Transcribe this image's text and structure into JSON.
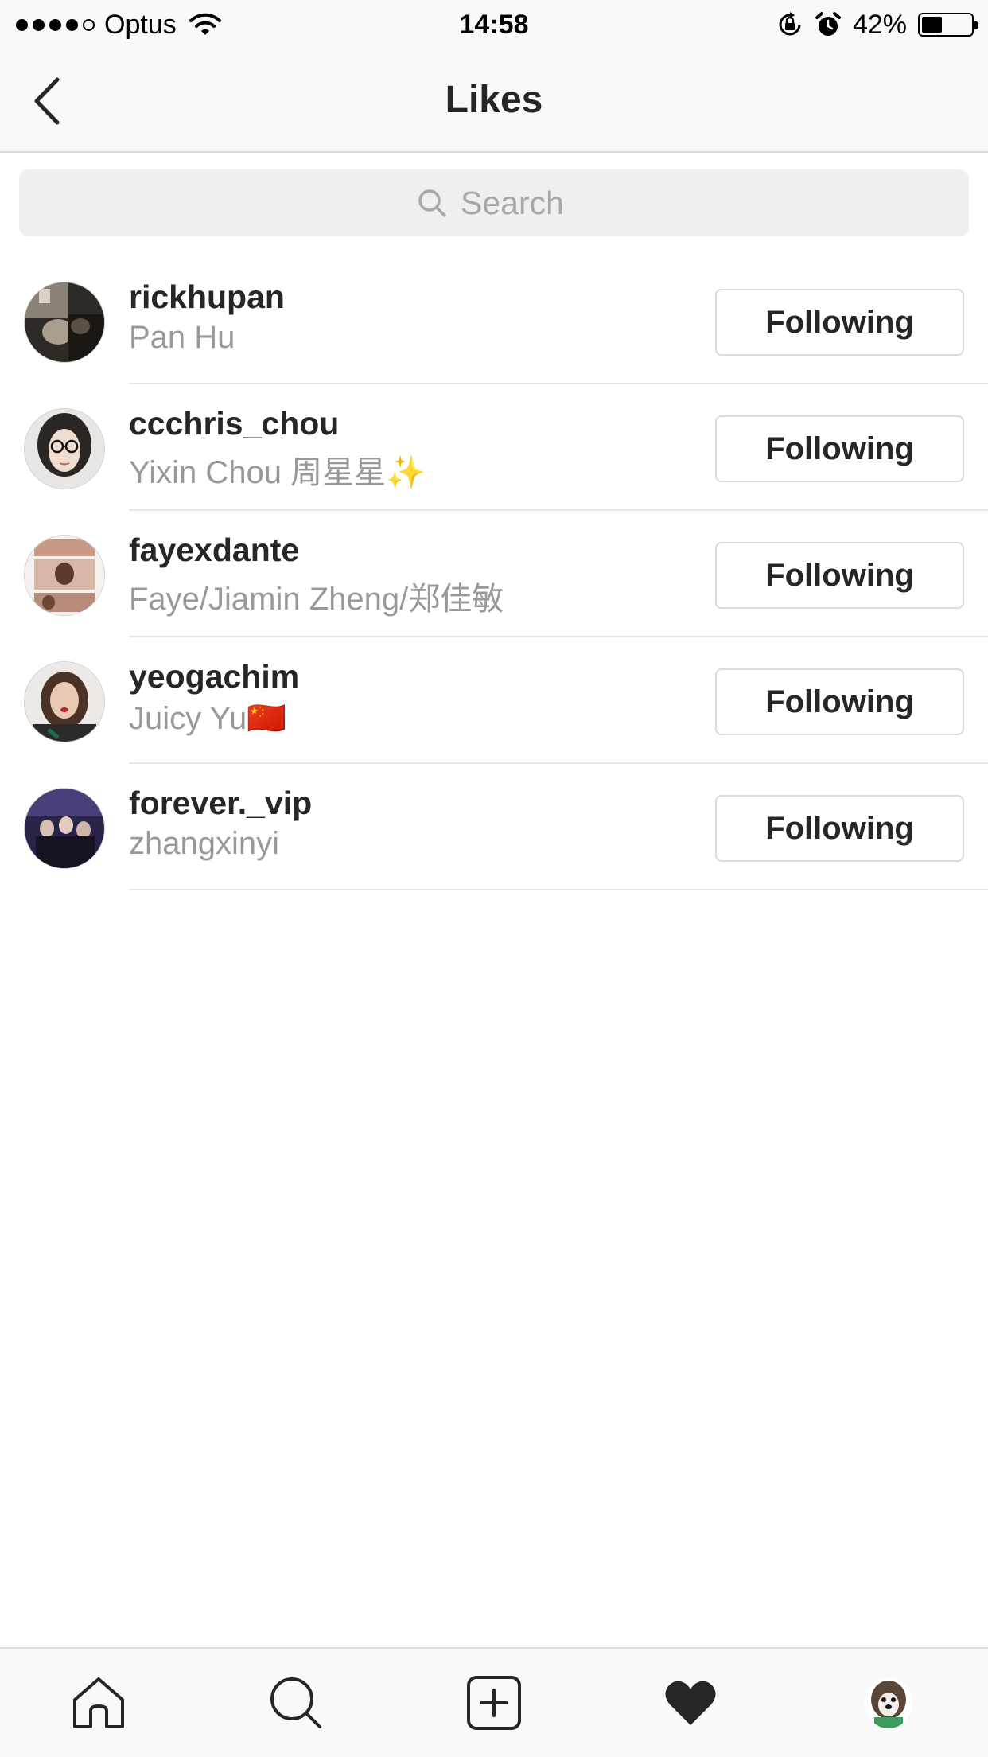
{
  "status_bar": {
    "carrier": "Optus",
    "time": "14:58",
    "battery_percent": "42%",
    "battery_level": 0.42,
    "signal_bars": 4,
    "signal_bars_total": 5
  },
  "nav": {
    "title": "Likes",
    "back_icon": "chevron-left-icon"
  },
  "search": {
    "placeholder": "Search",
    "value": "",
    "icon": "search-icon"
  },
  "likes": [
    {
      "username": "rickhupan",
      "full_name": "Pan Hu",
      "button_label": "Following"
    },
    {
      "username": "ccchris_chou",
      "full_name": "Yixin Chou 周星星✨",
      "button_label": "Following"
    },
    {
      "username": "fayexdante",
      "full_name": "Faye/Jiamin Zheng/郑佳敏",
      "button_label": "Following"
    },
    {
      "username": "yeogachim",
      "full_name": "Juicy Yu🇨🇳",
      "button_label": "Following"
    },
    {
      "username": "forever._vip",
      "full_name": "zhangxinyi",
      "button_label": "Following"
    }
  ],
  "tab_bar": {
    "items": [
      "home-icon",
      "search-icon",
      "add-post-icon",
      "heart-icon",
      "profile-avatar"
    ],
    "active": "heart-icon"
  },
  "colors": {
    "text_primary": "#262626",
    "text_secondary": "#999999",
    "bar_background": "#f9f9f9",
    "divider": "#dbdbdb",
    "search_background": "#efefef"
  }
}
